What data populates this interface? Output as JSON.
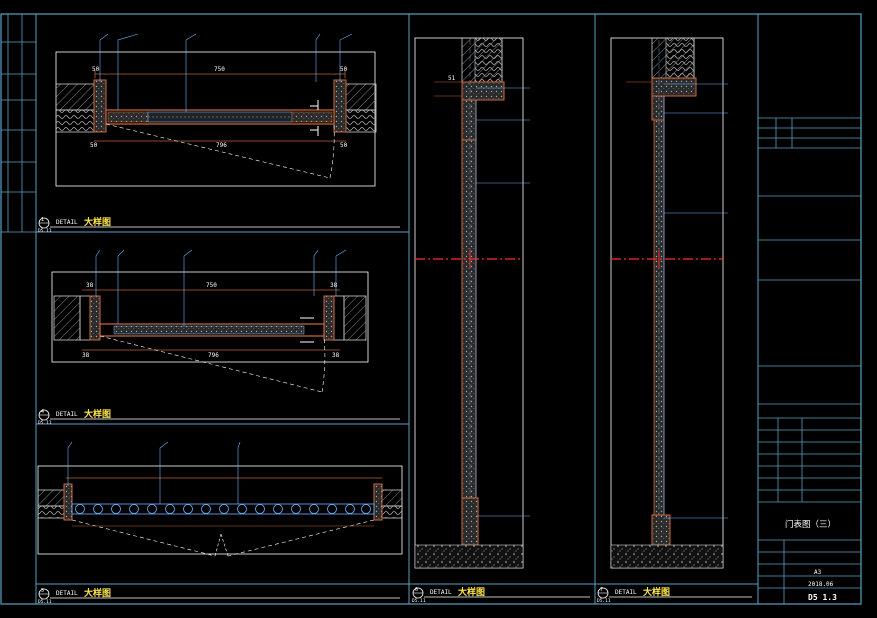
{
  "colors": {
    "background": "#000000",
    "frame": "#5a9fc0",
    "wall_outline": "#d0683a",
    "dimension": "#c06030",
    "leader": "#6fb4ff",
    "axis": "#ff2b2b",
    "text_white": "#ffffff",
    "text_yellow": "#ffe84a",
    "panel_hatch": "#a8a8a8"
  },
  "details": {
    "d1": {
      "number": "1",
      "detail_word": "DETAIL",
      "title": "大样图",
      "ref": "D5.11"
    },
    "d4": {
      "number": "4",
      "detail_word": "DETAIL",
      "title": "大样图",
      "ref": "D5.11"
    },
    "d5": {
      "number": "5",
      "detail_word": "DETAIL",
      "title": "大样图",
      "ref": "D5.11"
    },
    "d6": {
      "number": "6",
      "detail_word": "DETAIL",
      "title": "大样图",
      "ref": "D5.11"
    },
    "d7": {
      "number": "7",
      "detail_word": "DETAIL",
      "title": "大样图",
      "ref": "D5.11"
    }
  },
  "dimensions": {
    "d1": {
      "overall": "750",
      "left_jamb": "50",
      "right_jamb": "50",
      "swing": "796"
    },
    "d4": {
      "overall": "750",
      "left_jamb": "38",
      "right_jamb": "38",
      "swing": "796"
    },
    "d6": {
      "overall": "51"
    }
  },
  "title_block": {
    "drawing_name": "门表图（三）",
    "scale": "A3",
    "date": "2018.06",
    "sheet_number": "D5 1.3"
  },
  "icons": [
    "north-arrow-none"
  ]
}
